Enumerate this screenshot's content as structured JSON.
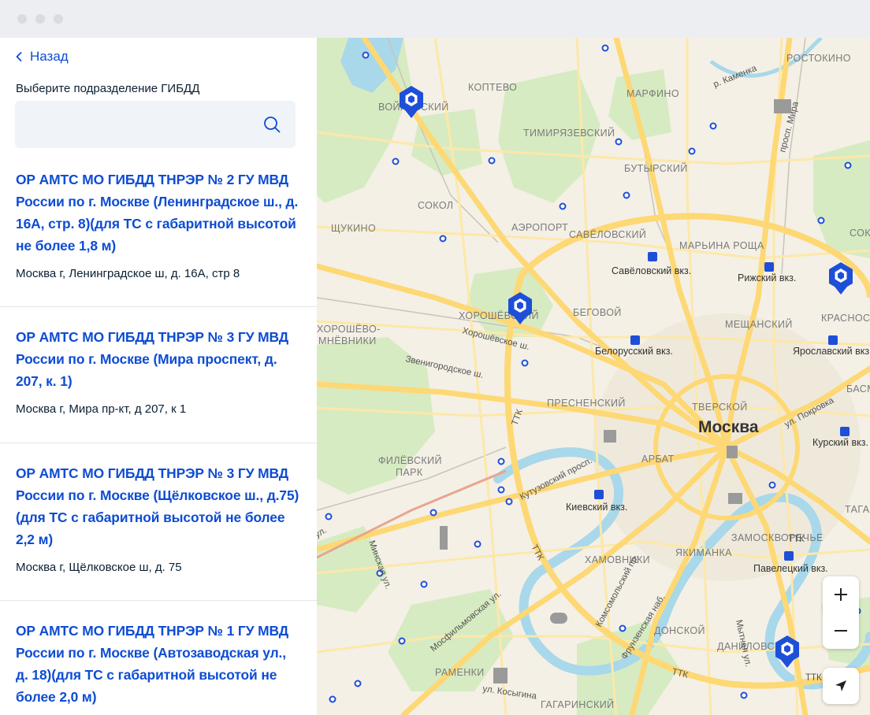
{
  "nav": {
    "back_label": "Назад"
  },
  "search": {
    "label": "Выберите подразделение ГИБДД",
    "placeholder": "",
    "value": ""
  },
  "departments": [
    {
      "title": "ОР АМТС МО ГИБДД ТНРЭР № 2 ГУ МВД России по г. Москве (Ленинградское ш., д. 16А, стр. 8)(для ТС с габаритной высотой не более 1,8 м)",
      "address": "Москва г, Ленинградское ш, д. 16А, стр 8"
    },
    {
      "title": "ОР АМТС МО ГИБДД ТНРЭР № 3 ГУ МВД России по г. Москве (Мира проспект, д. 207, к. 1)",
      "address": "Москва г, Мира пр-кт, д 207, к 1"
    },
    {
      "title": "ОР АМТС МО ГИБДД ТНРЭР № 3 ГУ МВД России по г. Москве (Щёлковское ш., д.75) (для ТС с габаритной высотой не более 2,2 м)",
      "address": "Москва г, Щёлковское ш, д. 75"
    },
    {
      "title": "ОР АМТС МО ГИБДД ТНРЭР № 1 ГУ МВД России по г. Москве (Автозаводская ул., д. 18)(для ТС с габаритной высотой не более 2,0 м)",
      "address": ""
    }
  ],
  "map": {
    "city": "Москва",
    "districts": {
      "koptevo": "КОПТЕВО",
      "marfino": "МАРФИНО",
      "rostokino": "РОСТОКИНО",
      "voykovsky": "ВОЙКОВСКИЙ",
      "timiryazevsky": "ТИМИРЯЗЕВСКИЙ",
      "butyrsky": "БУТЫРСКИЙ",
      "sokol": "СОКОЛ",
      "shchukino": "ЩУКИНО",
      "aeroport": "АЭРОПОРТ",
      "savelovsky": "САВЁЛОВСКИЙ",
      "maryina_roshcha": "МАРЬИНА РОЩА",
      "sokolniki": "СОК",
      "khoroshevsky": "ХОРОШЁВСКИЙ",
      "begovoy": "БЕГОВОЙ",
      "meshchansky": "МЕЩАНСКИЙ",
      "krasnoselsky": "КРАСНОСЕЛЬ",
      "khoroshevo_1": "ХОРОШЁВО-",
      "khoroshevo_2": "МНЁВНИКИ",
      "presnensky": "ПРЕСНЕНСКИЙ",
      "tverskoy": "ТВЕРСКОЙ",
      "basmanny": "БАСМА",
      "filevsky_1": "ФИЛЁВСКИЙ",
      "filevsky_2": "ПАРК",
      "arbat": "АРБАТ",
      "tagansky": "ТАГАНС",
      "zamoskvorechye": "ЗАМОСКВОРЕЧЬЕ",
      "yakimanka": "ЯКИМАНКА",
      "khamovniki": "ХАМОВНИКИ",
      "donskoy": "ДОНСКОЙ",
      "danilovsky": "ДАНИЛОВСКИЙ",
      "ramenki": "РАМЕНКИ",
      "gagarinsky": "ГАГАРИНСКИЙ"
    },
    "stations": {
      "savelovsky": "Савёловский вкз.",
      "rizhsky": "Рижский вкз.",
      "belorussky": "Белорусский вкз.",
      "yaroslavsky": "Ярославский вкз.",
      "kursky": "Курский вкз.",
      "kievsky": "Киевский вкз.",
      "paveletsky": "Павелецкий вкз."
    },
    "streets": {
      "kamenka": "р. Каменка",
      "prosp_mira": "просп. Мира",
      "khoroshevskoe": "Хорошёвское ш.",
      "zvenigorodskoe": "Звенигородское ш.",
      "ttk": "ТТК",
      "pokrovka": "ул. Покровка",
      "kutuzovsky": "Кутузовский просп.",
      "minskaya": "Минская ул.",
      "vereyskaya": "ул.",
      "mosfilmovskaya": "Мосфильмовская ул.",
      "komsomolsky": "Комсомольский пр.",
      "frunzenskaya": "Фрунзенская наб.",
      "mytnaya": "Мытная ул.",
      "kosygina": "ул. Косыгина"
    },
    "zoom_in_label": "+",
    "zoom_out_label": "−"
  },
  "colors": {
    "accent": "#0d4cd3",
    "pin": "#1e4fd8",
    "road": "#fdde8c",
    "park": "#d8ecc2",
    "water": "#a8d8ea"
  }
}
